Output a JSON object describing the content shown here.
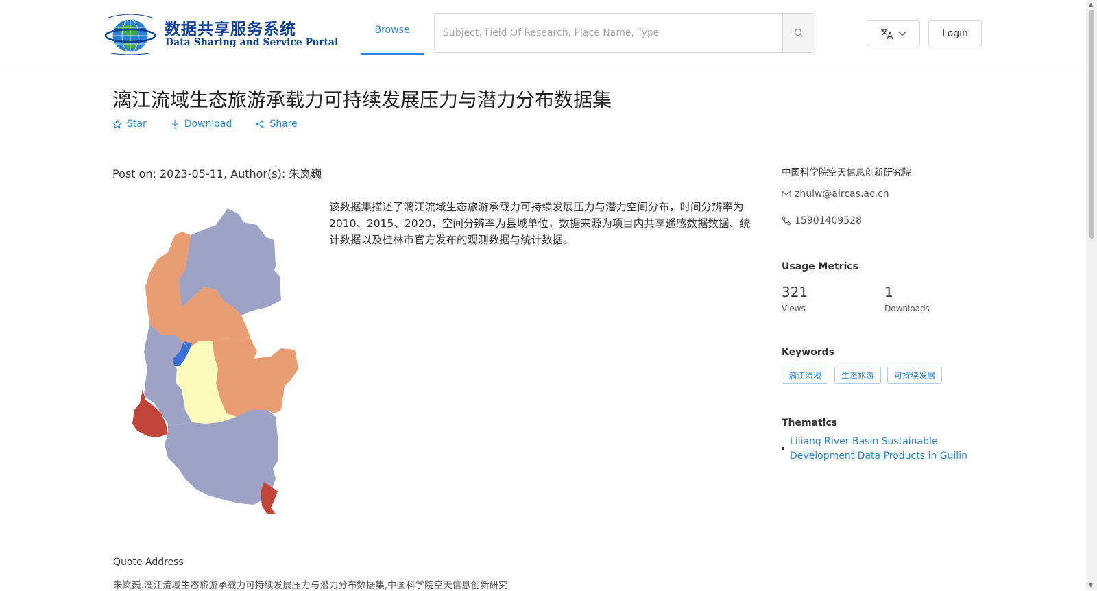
{
  "header": {
    "logo_cn": "数据共享服务系统",
    "logo_en": "Data Sharing and Service Portal",
    "nav_browse": "Browse",
    "search_placeholder": "Subject, Field Of Research, Place Name, Type",
    "login_label": "Login"
  },
  "dataset": {
    "title": "漓江流域生态旅游承载力可持续发展压力与潜力分布数据集",
    "actions": {
      "star": "Star",
      "download": "Download",
      "share": "Share"
    },
    "post_line": "Post on: 2023-05-11, Author(s): 朱岚巍",
    "description": "该数据集描述了漓江流域生态旅游承载力可持续发展压力与潜力空间分布，时间分辨率为2010、2015、2020，空间分辨率为县域单位，数据来源为项目内共享遥感数据数据、统计数据以及桂林市官方发布的观测数据与统计数据。",
    "quote_label": "Quote Address",
    "quote_text": "朱岚巍.漓江流域生态旅游承载力可持续发展压力与潜力分布数据集,中国科学院空天信息创新研究"
  },
  "sidebar": {
    "organization": "中国科学院空天信息创新研究院",
    "email": "zhulw@aircas.ac.cn",
    "phone": "15901409528",
    "usage_title": "Usage Metrics",
    "views_value": "321",
    "views_label": "Views",
    "downloads_value": "1",
    "downloads_label": "Downloads",
    "keywords_title": "Keywords",
    "keywords": [
      "漓江流域",
      "生态旅游",
      "可持续发展"
    ],
    "thematics_title": "Thematics",
    "thematic_link": "Lijiang River Basin Sustainable Development Data Products in Guilin"
  },
  "colors": {
    "accent": "#2e86de",
    "map_blue_grey": "#9ea3c6",
    "map_orange": "#e89d72",
    "map_yellow": "#fdfbbc",
    "map_red": "#c0463a",
    "map_blue": "#3a6fd6"
  }
}
